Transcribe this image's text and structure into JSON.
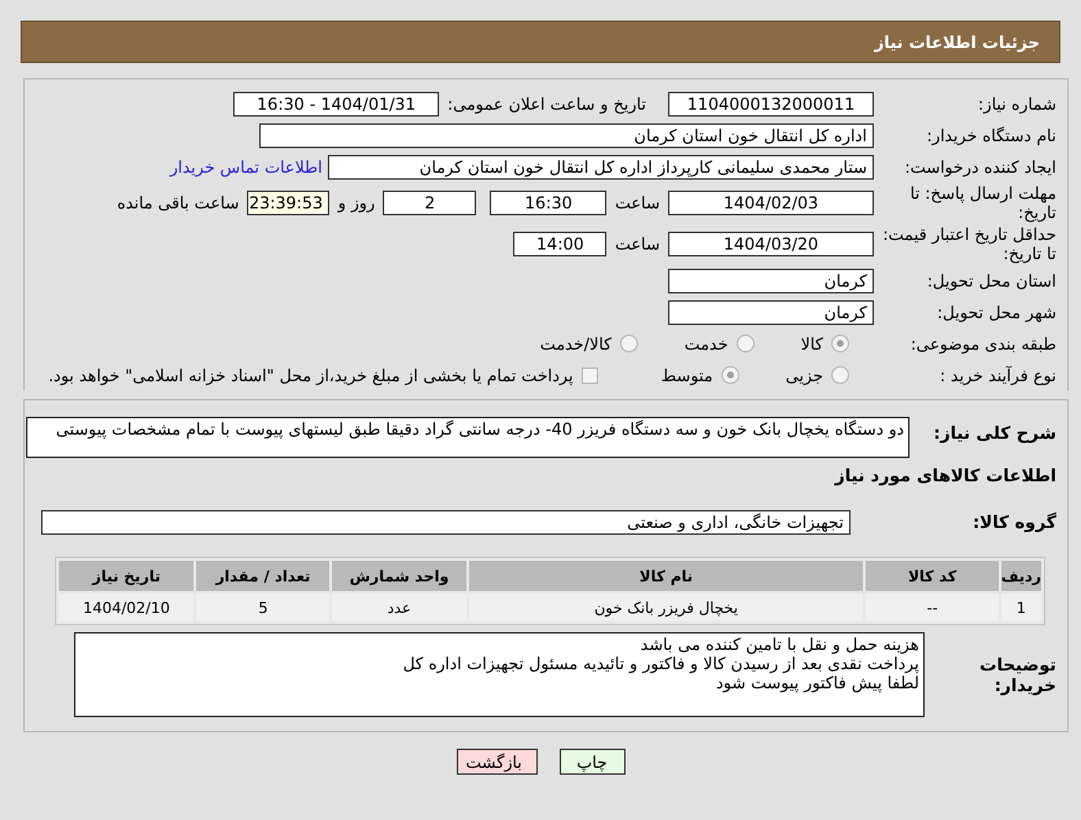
{
  "header": {
    "title": "جزئیات اطلاعات نیاز"
  },
  "need_number": {
    "label": "شماره نیاز:",
    "value": "1104000132000011"
  },
  "announce": {
    "label": "تاریخ و ساعت اعلان عمومی:",
    "value": "1404/01/31 - 16:30"
  },
  "buyer": {
    "label": "نام دستگاه خریدار:",
    "value": "اداره کل انتقال خون استان کرمان"
  },
  "creator": {
    "label": "ایجاد کننده درخواست:",
    "value": "ستار محمدی سلیمانی کارپرداز اداره کل انتقال خون استان کرمان",
    "link": "اطلاعات تماس خریدار"
  },
  "deadline": {
    "label": "مهلت ارسال پاسخ: تا تاریخ:",
    "date": "1404/02/03",
    "time_label": "ساعت",
    "time": "16:30",
    "days": "2",
    "days_label": "روز و",
    "remaining": "23:39:53",
    "remaining_label": "ساعت باقی مانده"
  },
  "validity": {
    "label": "حداقل تاریخ اعتبار قیمت: تا تاریخ:",
    "date": "1404/03/20",
    "time_label": "ساعت",
    "time": "14:00"
  },
  "province": {
    "label": "استان محل تحویل:",
    "value": "کرمان"
  },
  "city": {
    "label": "شهر محل تحویل:",
    "value": "کرمان"
  },
  "category": {
    "label": "طبقه بندی موضوعی:",
    "options": [
      {
        "label": "کالا",
        "selected": true
      },
      {
        "label": "خدمت",
        "selected": false
      },
      {
        "label": "کالا/خدمت",
        "selected": false
      }
    ]
  },
  "process": {
    "label": "نوع فرآیند خرید :",
    "options": [
      {
        "label": "جزیی",
        "selected": false
      },
      {
        "label": "متوسط",
        "selected": true
      }
    ],
    "checkbox": {
      "checked": false,
      "text": "پرداخت تمام یا بخشی از مبلغ خرید،از محل \"اسناد خزانه اسلامی\" خواهد بود."
    }
  },
  "description": {
    "label": "شرح کلی نیاز:",
    "value": "دو دستگاه یخچال بانک خون   و سه دستگاه فریزر 40- درجه سانتی گراد دقیقا طبق لیستهای پیوست با تمام مشخصات پیوستی"
  },
  "items_title": "اطلاعات کالاهای مورد نیاز",
  "group": {
    "label": "گروه کالا:",
    "value": "تجهیزات خانگی، اداری و صنعتی"
  },
  "table": {
    "columns": [
      "ردیف",
      "کد کالا",
      "نام کالا",
      "واحد شمارش",
      "تعداد / مقدار",
      "تاریخ نیاز"
    ],
    "rows": [
      [
        "1",
        "--",
        "یخچال فریزر بانک خون",
        "عدد",
        "5",
        "1404/02/10"
      ]
    ]
  },
  "buyer_notes": {
    "label": "توضیحات خریدار:",
    "lines": [
      "هزینه حمل و نقل با تامین کننده می باشد",
      "پرداخت نقدی بعد از رسیدن کالا و فاکتور و تائیدیه مسئول تجهیزات اداره کل",
      "لطفا پیش فاکتور پیوست شود"
    ]
  },
  "buttons": [
    {
      "label": "چاپ",
      "kind": "print"
    },
    {
      "label": "بازگشت",
      "kind": "back"
    }
  ]
}
